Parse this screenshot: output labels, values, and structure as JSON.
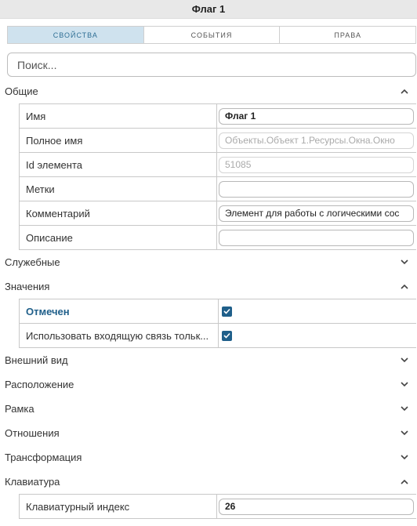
{
  "window": {
    "title": "Флаг 1"
  },
  "tabs": [
    {
      "label": "СВОЙСТВА",
      "active": true
    },
    {
      "label": "СОБЫТИЯ",
      "active": false
    },
    {
      "label": "ПРАВА",
      "active": false
    }
  ],
  "search": {
    "placeholder": "Поиск..."
  },
  "sections": {
    "general": {
      "title": "Общие",
      "expanded": true,
      "rows": [
        {
          "label": "Имя",
          "value": "Флаг 1"
        },
        {
          "label": "Полное имя",
          "value": "Объекты.Объект 1.Ресурсы.Окна.Окно"
        },
        {
          "label": "Id элемента",
          "value": "51085"
        },
        {
          "label": "Метки",
          "value": ""
        },
        {
          "label": "Комментарий",
          "value": "Элемент для работы с логическими сос"
        },
        {
          "label": "Описание",
          "value": ""
        }
      ]
    },
    "service": {
      "title": "Служебные",
      "expanded": false
    },
    "values": {
      "title": "Значения",
      "expanded": true,
      "rows": [
        {
          "label": "Отмечен",
          "checked": true
        },
        {
          "label": "Использовать входящую связь тольк...",
          "checked": true
        }
      ]
    },
    "appearance": {
      "title": "Внешний вид",
      "expanded": false
    },
    "position": {
      "title": "Расположение",
      "expanded": false
    },
    "frame": {
      "title": "Рамка",
      "expanded": false
    },
    "relations": {
      "title": "Отношения",
      "expanded": false
    },
    "transform": {
      "title": "Трансформация",
      "expanded": false
    },
    "keyboard": {
      "title": "Клавиатура",
      "expanded": true,
      "rows": [
        {
          "label": "Клавиатурный индекс",
          "value": "26"
        }
      ]
    }
  },
  "colors": {
    "accent": "#1f5f8a",
    "tab_active_bg": "#cfe2ee",
    "titlebar_bg": "#e8e8e8"
  }
}
